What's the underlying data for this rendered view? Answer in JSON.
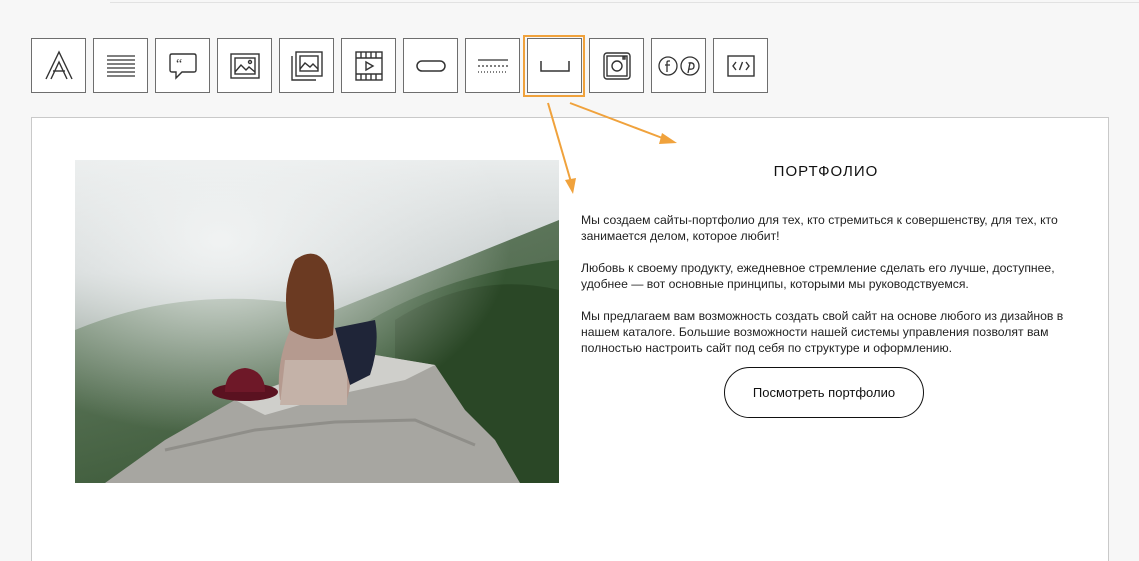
{
  "toolbar": {
    "tools": [
      {
        "name": "text-style-tool",
        "icon": "letter-a-icon"
      },
      {
        "name": "paragraph-tool",
        "icon": "lines-icon"
      },
      {
        "name": "quote-tool",
        "icon": "quote-bubble-icon"
      },
      {
        "name": "image-tool",
        "icon": "picture-icon"
      },
      {
        "name": "gallery-tool",
        "icon": "stacked-pictures-icon"
      },
      {
        "name": "video-tool",
        "icon": "film-play-icon"
      },
      {
        "name": "button-tool",
        "icon": "pill-button-icon"
      },
      {
        "name": "divider-tool",
        "icon": "dashed-lines-icon"
      },
      {
        "name": "spacer-tool",
        "icon": "spacer-bracket-icon",
        "selected": true
      },
      {
        "name": "instagram-tool",
        "icon": "instagram-icon"
      },
      {
        "name": "social-tool",
        "icon": "facebook-pinterest-icon"
      },
      {
        "name": "code-tool",
        "icon": "code-brackets-icon"
      }
    ],
    "selection_color": "#f0a23c"
  },
  "content": {
    "title": "ПОРТФОЛИО",
    "paragraph_1": "Мы создаем сайты-портфолио для тех, кто стремиться к совершенству, для тех, кто занимается делом, которое любит!",
    "paragraph_2": "Любовь к своему продукту, ежедневное стремление сделать его лучше, доступнее, удобнее — вот основные принципы, которыми мы руководствуемся.",
    "paragraph_3": "Мы предлагаем вам возможность создать свой сайт на основе любого из дизайнов в нашем каталоге. Большие возможности нашей системы управления позволят вам полностью настроить сайт под себя по структуре и оформлению.",
    "button_label": "Посмотреть портфолио"
  },
  "annotation_color": "#f0a23c"
}
